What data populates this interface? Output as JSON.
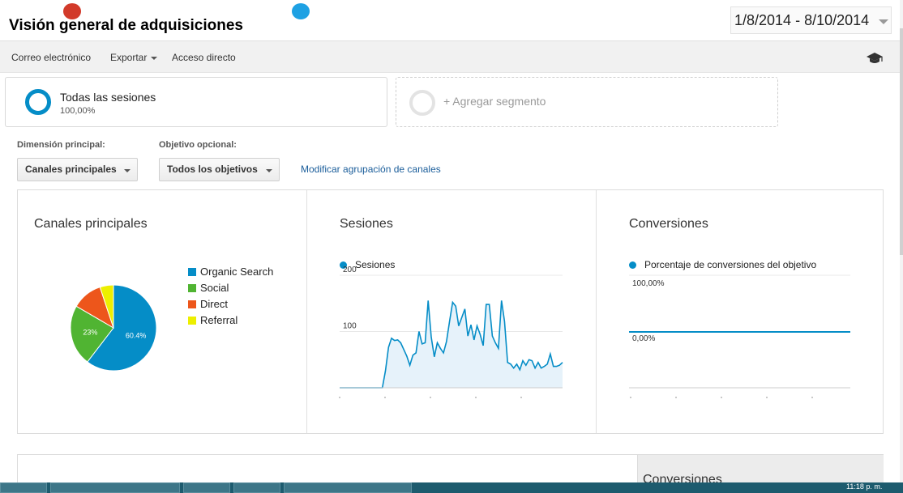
{
  "header": {
    "title": "Visión general de adquisiciones",
    "date_range": "1/8/2014 - 8/10/2014"
  },
  "toolbar": {
    "email": "Correo electrónico",
    "export": "Exportar",
    "shortcut": "Acceso directo"
  },
  "segments": {
    "active": {
      "name": "Todas las sesiones",
      "percent": "100,00%"
    },
    "add_label": "+ Agregar segmento"
  },
  "filters": {
    "primary_dimension_label": "Dimensión principal:",
    "primary_dimension_value": "Canales principales",
    "goal_label": "Objetivo opcional:",
    "goal_value": "Todos los objetivos",
    "modify_link": "Modificar agrupación de canales"
  },
  "cards": {
    "channels_title": "Canales principales",
    "sessions_title": "Sesiones",
    "conversions_title": "Conversiones"
  },
  "bottom": {
    "right_title": "Conversiones"
  },
  "taskbar": {
    "clock": "11:18 p. m."
  },
  "chart_data": [
    {
      "type": "pie",
      "title": "Canales principales",
      "categories": [
        "Organic Search",
        "Social",
        "Direct",
        "Referral"
      ],
      "values": [
        60.4,
        23,
        11.5,
        5.1
      ],
      "slice_labels": [
        "60.4%",
        "23%",
        "",
        ""
      ],
      "colors": [
        "#058dc7",
        "#50b432",
        "#ed561b",
        "#edef00"
      ],
      "legend": "right"
    },
    {
      "type": "area",
      "title": "Sesiones",
      "series": [
        {
          "name": "Sesiones",
          "color": "#058dc7",
          "values": [
            0,
            0,
            0,
            0,
            0,
            0,
            0,
            0,
            0,
            0,
            0,
            0,
            0,
            0,
            0,
            30,
            72,
            88,
            84,
            85,
            80,
            68,
            56,
            40,
            58,
            62,
            100,
            78,
            80,
            155,
            90,
            55,
            80,
            70,
            62,
            82,
            118,
            152,
            145,
            110,
            125,
            140,
            92,
            112,
            85,
            110,
            95,
            75,
            148,
            148,
            92,
            80,
            70,
            155,
            118,
            45,
            42,
            35,
            42,
            32,
            48,
            40,
            50,
            48,
            35,
            45,
            35,
            38,
            42,
            60,
            38,
            38,
            40,
            45
          ]
        }
      ],
      "yticks": [
        100,
        200
      ],
      "ylim": [
        0,
        200
      ],
      "grid": true
    },
    {
      "type": "line",
      "title": "Conversiones",
      "series": [
        {
          "name": "Porcentaje de conversiones del objetivo",
          "color": "#058dc7",
          "constant": 0
        }
      ],
      "yticks": [
        "100,00%",
        "0,00%"
      ],
      "ylim": [
        0,
        100
      ],
      "grid": true
    }
  ]
}
